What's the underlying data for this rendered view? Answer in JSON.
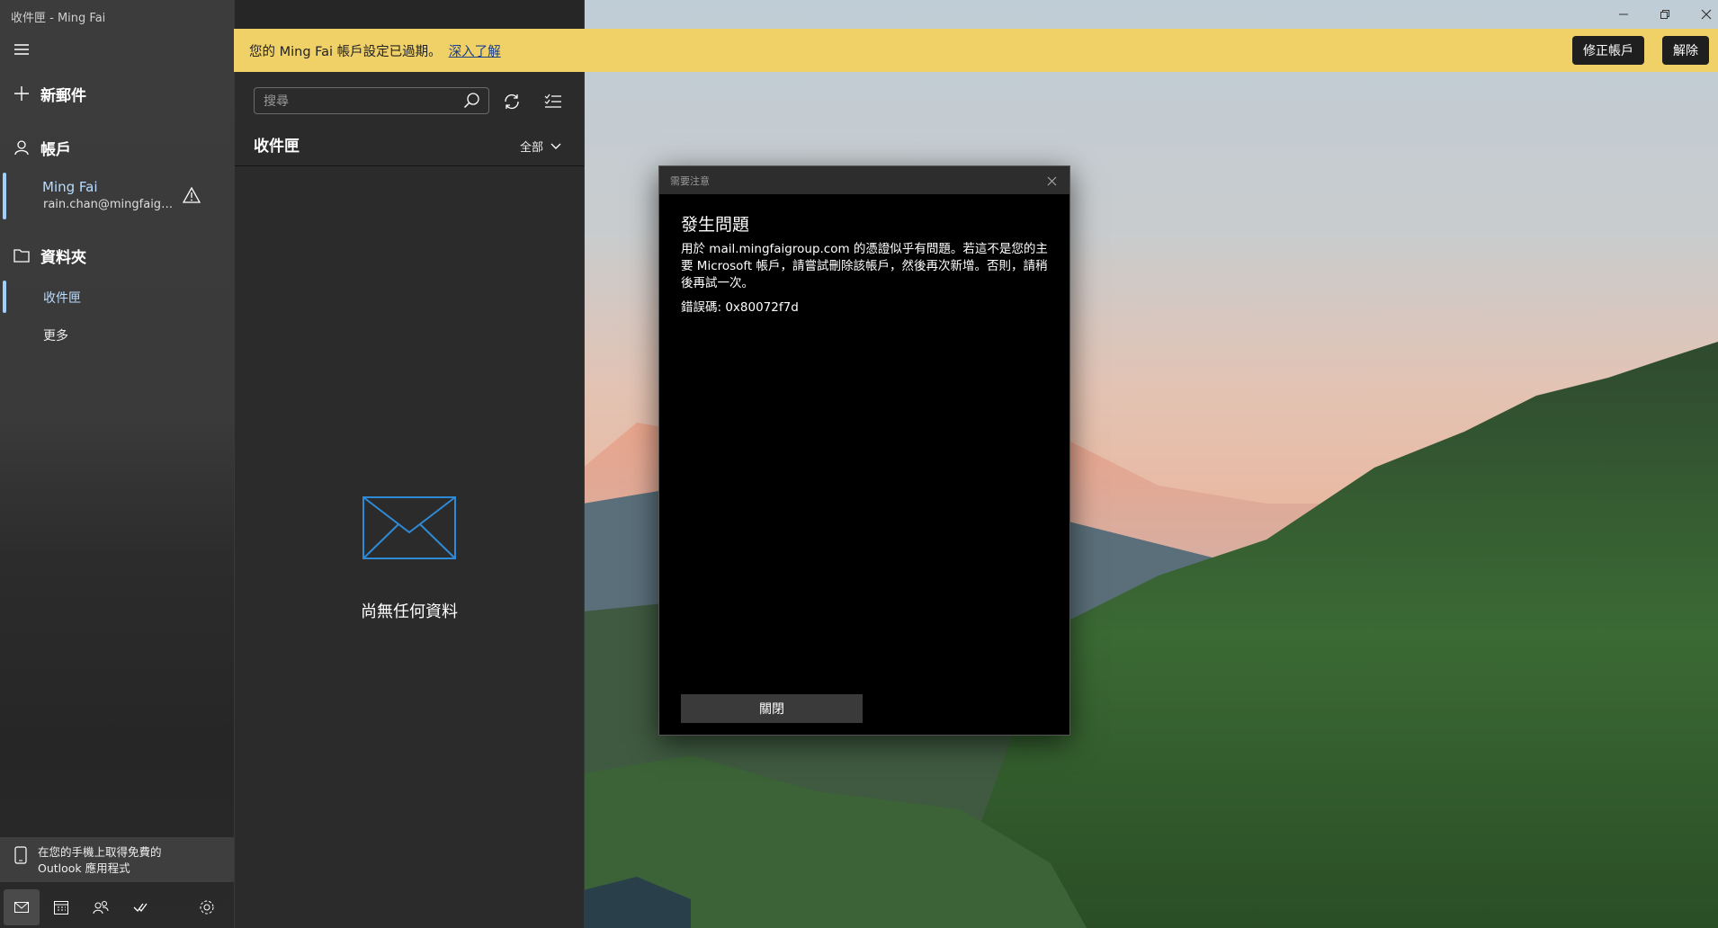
{
  "window": {
    "title": "收件匣 - Ming Fai",
    "minimize_icon": "minimize-icon",
    "restore_icon": "restore-icon",
    "close_icon": "close-icon"
  },
  "nav": {
    "menu_icon": "hamburger-icon",
    "new_mail": "新郵件",
    "accounts": "帳戶",
    "account": {
      "name": "Ming Fai",
      "email": "rain.chan@mingfaigr...",
      "status_icon": "warning-icon"
    },
    "folders": "資料夾",
    "folder_items": [
      {
        "label": "收件匣",
        "selected": true
      },
      {
        "label": "更多",
        "selected": false
      }
    ],
    "promo": "在您的手機上取得免費的 Outlook 應用程式",
    "bottom": [
      "mail-icon",
      "calendar-icon",
      "people-icon",
      "todo-icon",
      "settings-icon"
    ]
  },
  "banner": {
    "message": "您的 Ming Fai 帳戶設定已過期。",
    "link": "深入了解",
    "fix_button": "修正帳戶",
    "dismiss_button": "解除",
    "color": "#f0d168"
  },
  "list": {
    "search_placeholder": "搜尋",
    "title": "收件匣",
    "filter": "全部",
    "empty_text": "尚無任何資料"
  },
  "dialog": {
    "caption": "需要注意",
    "heading": "發生問題",
    "body": "用於 mail.mingfaigroup.com 的憑證似乎有問題。若這不是您的主要 Microsoft 帳戶，請嘗試刪除該帳戶，然後再次新增。否則，請稍後再試一次。",
    "error_code": "錯誤碼: 0x80072f7d",
    "close_button": "關閉"
  },
  "colors": {
    "accent": "#9fd0ff",
    "dialog_bg": "#000000"
  }
}
